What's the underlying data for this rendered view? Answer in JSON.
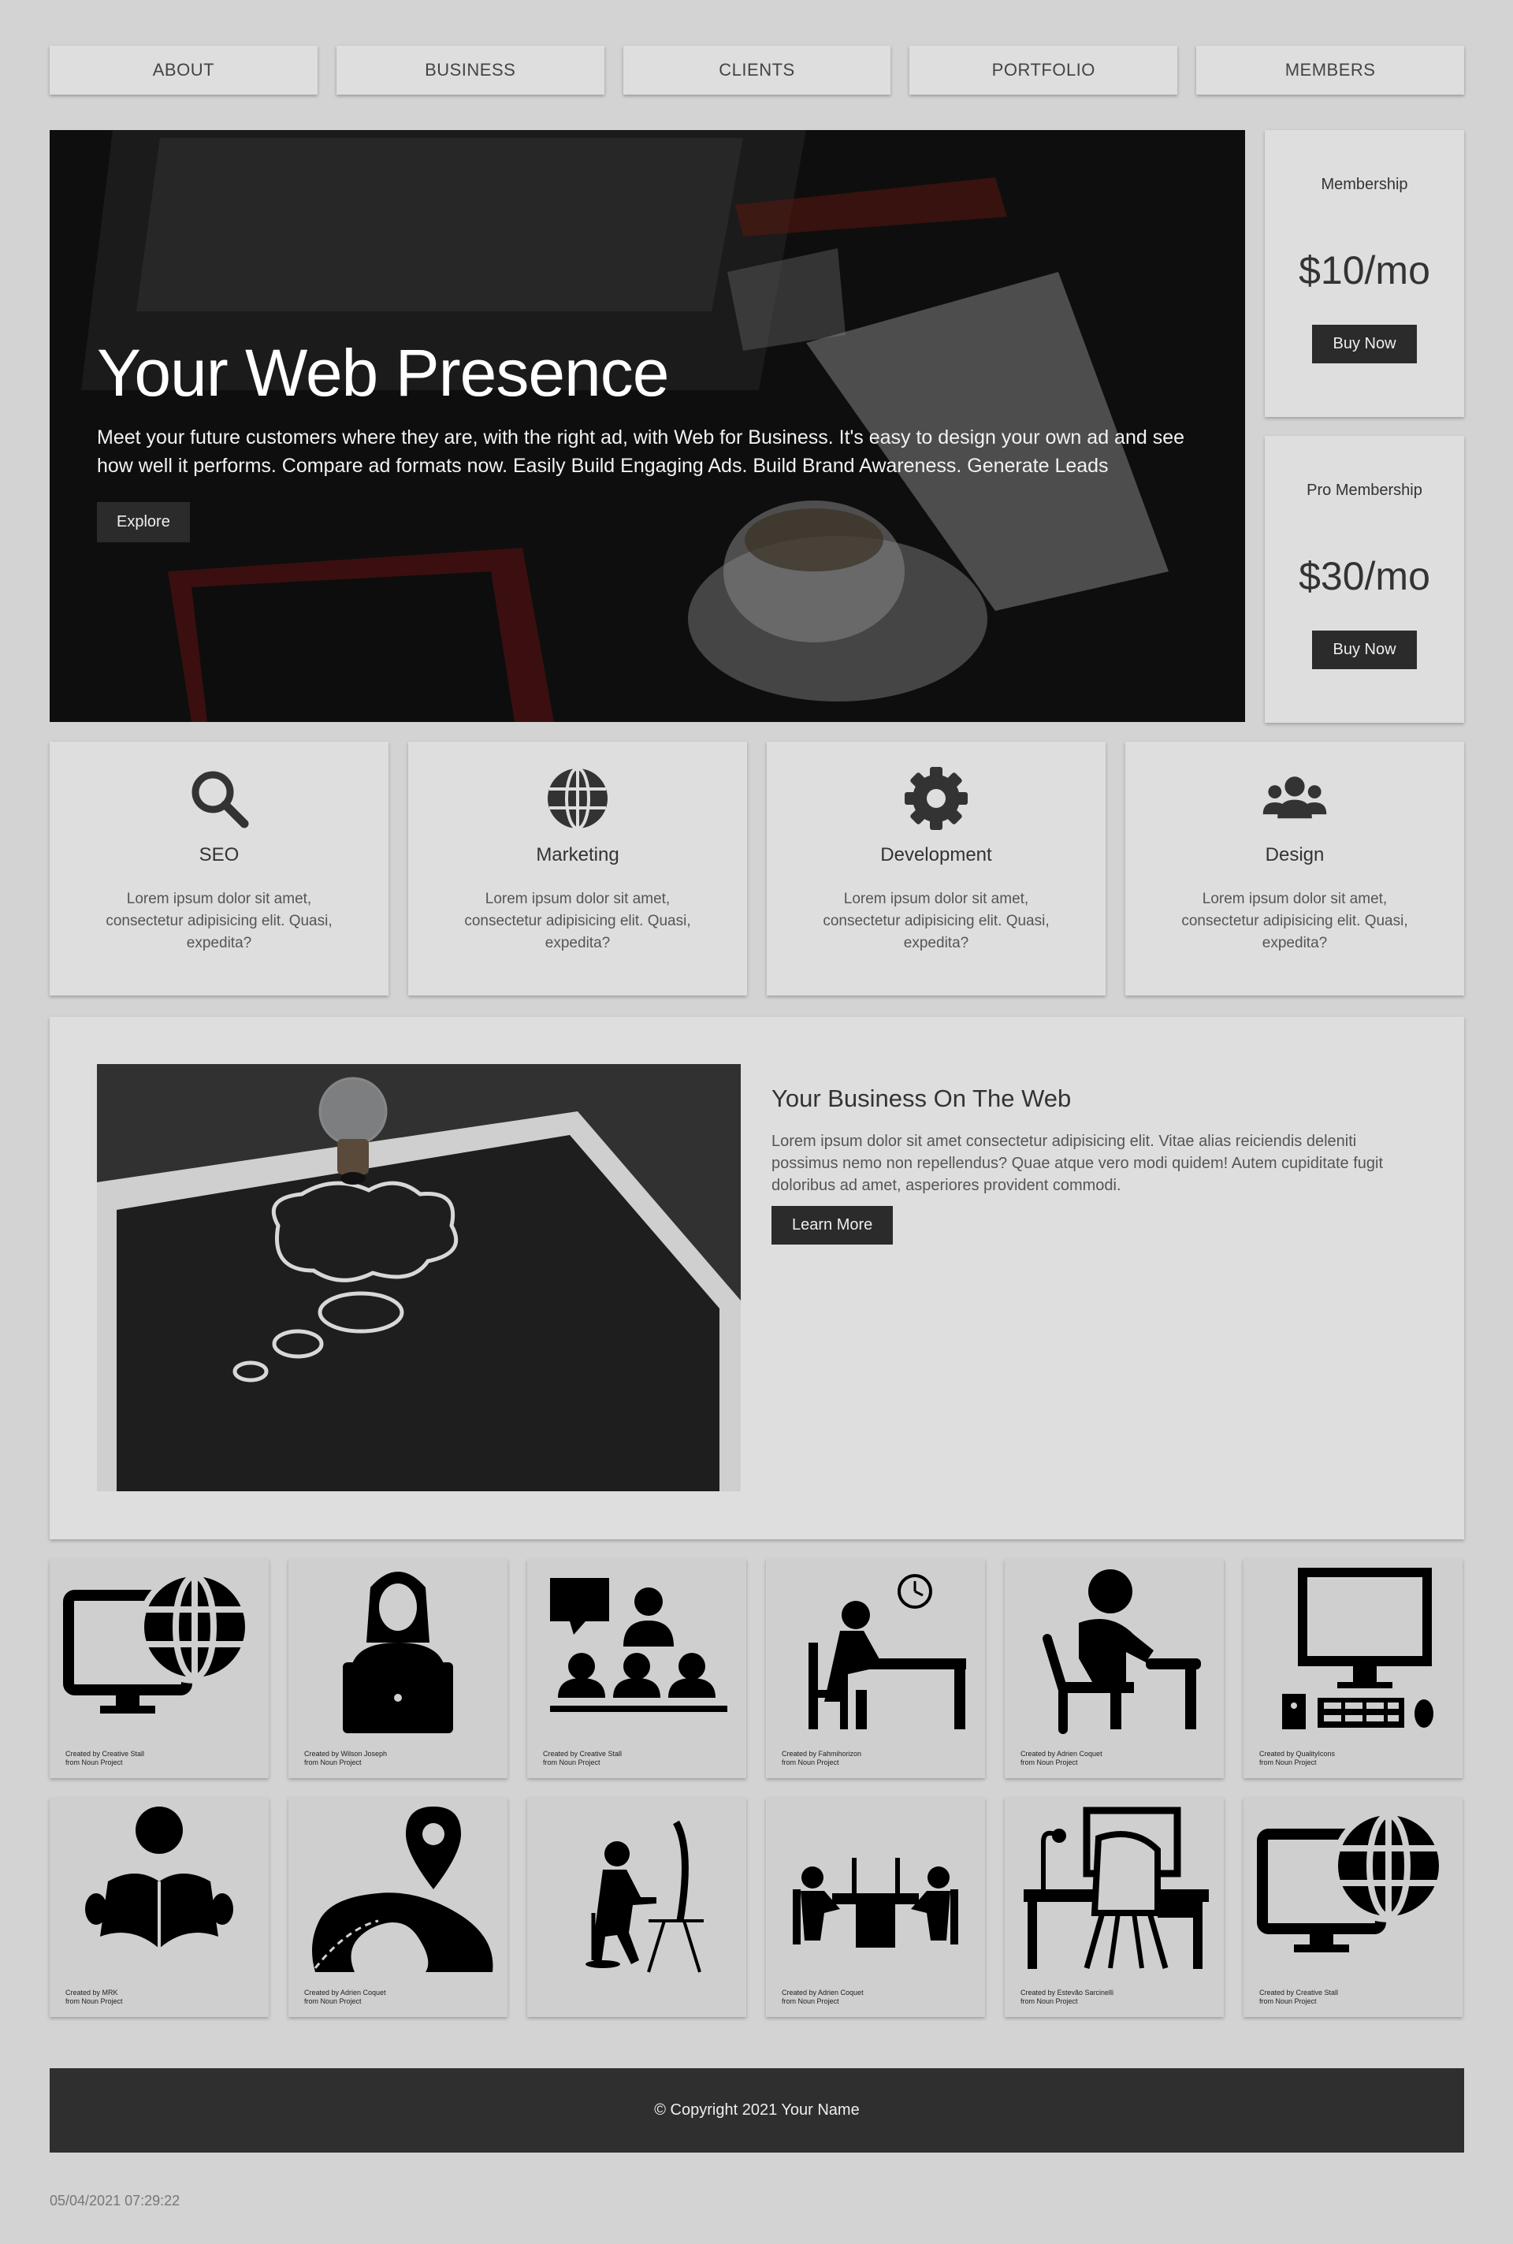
{
  "nav": {
    "items": [
      "ABOUT",
      "BUSINESS",
      "CLIENTS",
      "PORTFOLIO",
      "MEMBERS"
    ]
  },
  "hero": {
    "title": "Your Web Presence",
    "text": "Meet your future customers where they are, with the right ad, with Web for Business. It's easy to design your own ad and see how well it performs. Compare ad formats now. Easily Build Engaging Ads. Build Brand Awareness. Generate Leads",
    "button": "Explore"
  },
  "pricing": [
    {
      "name": "Membership",
      "price": "$10/mo",
      "button": "Buy Now"
    },
    {
      "name": "Pro Membership",
      "price": "$30/mo",
      "button": "Buy Now"
    }
  ],
  "features": [
    {
      "icon": "search-icon",
      "title": "SEO",
      "text": "Lorem ipsum dolor sit amet, consectetur adipisicing elit. Quasi, expedita?"
    },
    {
      "icon": "globe-icon",
      "title": "Marketing",
      "text": "Lorem ipsum dolor sit amet, consectetur adipisicing elit. Quasi, expedita?"
    },
    {
      "icon": "gear-icon",
      "title": "Development",
      "text": "Lorem ipsum dolor sit amet, consectetur adipisicing elit. Quasi, expedita?"
    },
    {
      "icon": "users-icon",
      "title": "Design",
      "text": "Lorem ipsum dolor sit amet, consectetur adipisicing elit. Quasi, expedita?"
    }
  ],
  "business": {
    "title": "Your Business On The Web",
    "text": "Lorem ipsum dolor sit amet consectetur adipisicing elit. Vitae alias reiciendis deleniti possimus nemo non repellendus? Quae atque vero modi quidem! Autem cupiditate fugit doloribus ad amet, asperiores provident commodi.",
    "button": "Learn More"
  },
  "icon_tiles": [
    {
      "icon": "computer-globe-icon",
      "credit_line1": "Created by Creative Stall",
      "credit_line2": "from Noun Project"
    },
    {
      "icon": "woman-laptop-icon",
      "credit_line1": "Created by Wilson Joseph",
      "credit_line2": "from Noun Project"
    },
    {
      "icon": "presentation-icon",
      "credit_line1": "Created by Creative Stall",
      "credit_line2": "from Noun Project"
    },
    {
      "icon": "person-desk-clock-icon",
      "credit_line1": "Created by Fahmihorizon",
      "credit_line2": "from Noun Project"
    },
    {
      "icon": "person-writing-icon",
      "credit_line1": "Created by Adrien Coquet",
      "credit_line2": "from Noun Project"
    },
    {
      "icon": "desktop-computer-icon",
      "credit_line1": "Created by QualityIcons",
      "credit_line2": "from Noun Project"
    },
    {
      "icon": "person-reading-icon",
      "credit_line1": "Created by MRK",
      "credit_line2": "from Noun Project"
    },
    {
      "icon": "road-location-icon",
      "credit_line1": "Created by Adrien Coquet",
      "credit_line2": "from Noun Project"
    },
    {
      "icon": "person-computer-icon",
      "credit_line1": "",
      "credit_line2": ""
    },
    {
      "icon": "meeting-table-icon",
      "credit_line1": "Created by Adrien Coquet",
      "credit_line2": "from Noun Project"
    },
    {
      "icon": "workspace-desk-icon",
      "credit_line1": "Created by Estevão Sarcinelli",
      "credit_line2": "from Noun Project"
    },
    {
      "icon": "computer-globe-icon",
      "credit_line1": "Created by Creative Stall",
      "credit_line2": "from Noun Project"
    }
  ],
  "footer": {
    "text": "© Copyright 2021 Your Name"
  },
  "timestamp": "05/04/2021 07:29:22"
}
